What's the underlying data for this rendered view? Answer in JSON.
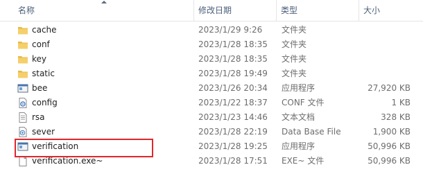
{
  "columns": {
    "name": "名称",
    "date": "修改日期",
    "type": "类型",
    "size": "大小"
  },
  "files": [
    {
      "name": "cache",
      "date": "2023/1/29 9:26",
      "type": "文件夹",
      "size": "",
      "icon": "folder-icon"
    },
    {
      "name": "conf",
      "date": "2023/1/28 18:35",
      "type": "文件夹",
      "size": "",
      "icon": "folder-icon"
    },
    {
      "name": "key",
      "date": "2023/1/28 18:35",
      "type": "文件夹",
      "size": "",
      "icon": "folder-icon"
    },
    {
      "name": "static",
      "date": "2023/1/28 19:49",
      "type": "文件夹",
      "size": "",
      "icon": "folder-icon"
    },
    {
      "name": "bee",
      "date": "2023/1/26 20:34",
      "type": "应用程序",
      "size": "27,920 KB",
      "icon": "application-icon"
    },
    {
      "name": "config",
      "date": "2023/1/22 18:37",
      "type": "CONF 文件",
      "size": "1 KB",
      "icon": "conf-file-icon"
    },
    {
      "name": "rsa",
      "date": "2023/1/23 14:46",
      "type": "文本文档",
      "size": "328 KB",
      "icon": "text-document-icon"
    },
    {
      "name": "sever",
      "date": "2023/1/28 22:19",
      "type": "Data Base File",
      "size": "1,900 KB",
      "icon": "database-file-icon"
    },
    {
      "name": "verification",
      "date": "2023/1/28 19:25",
      "type": "应用程序",
      "size": "50,996 KB",
      "icon": "application-icon"
    },
    {
      "name": "verification.exe~",
      "date": "2023/1/28 17:51",
      "type": "EXE~ 文件",
      "size": "50,996 KB",
      "icon": "blank-file-icon"
    }
  ],
  "highlight_color": "#e0262c",
  "folder_color": "#e8b84a"
}
